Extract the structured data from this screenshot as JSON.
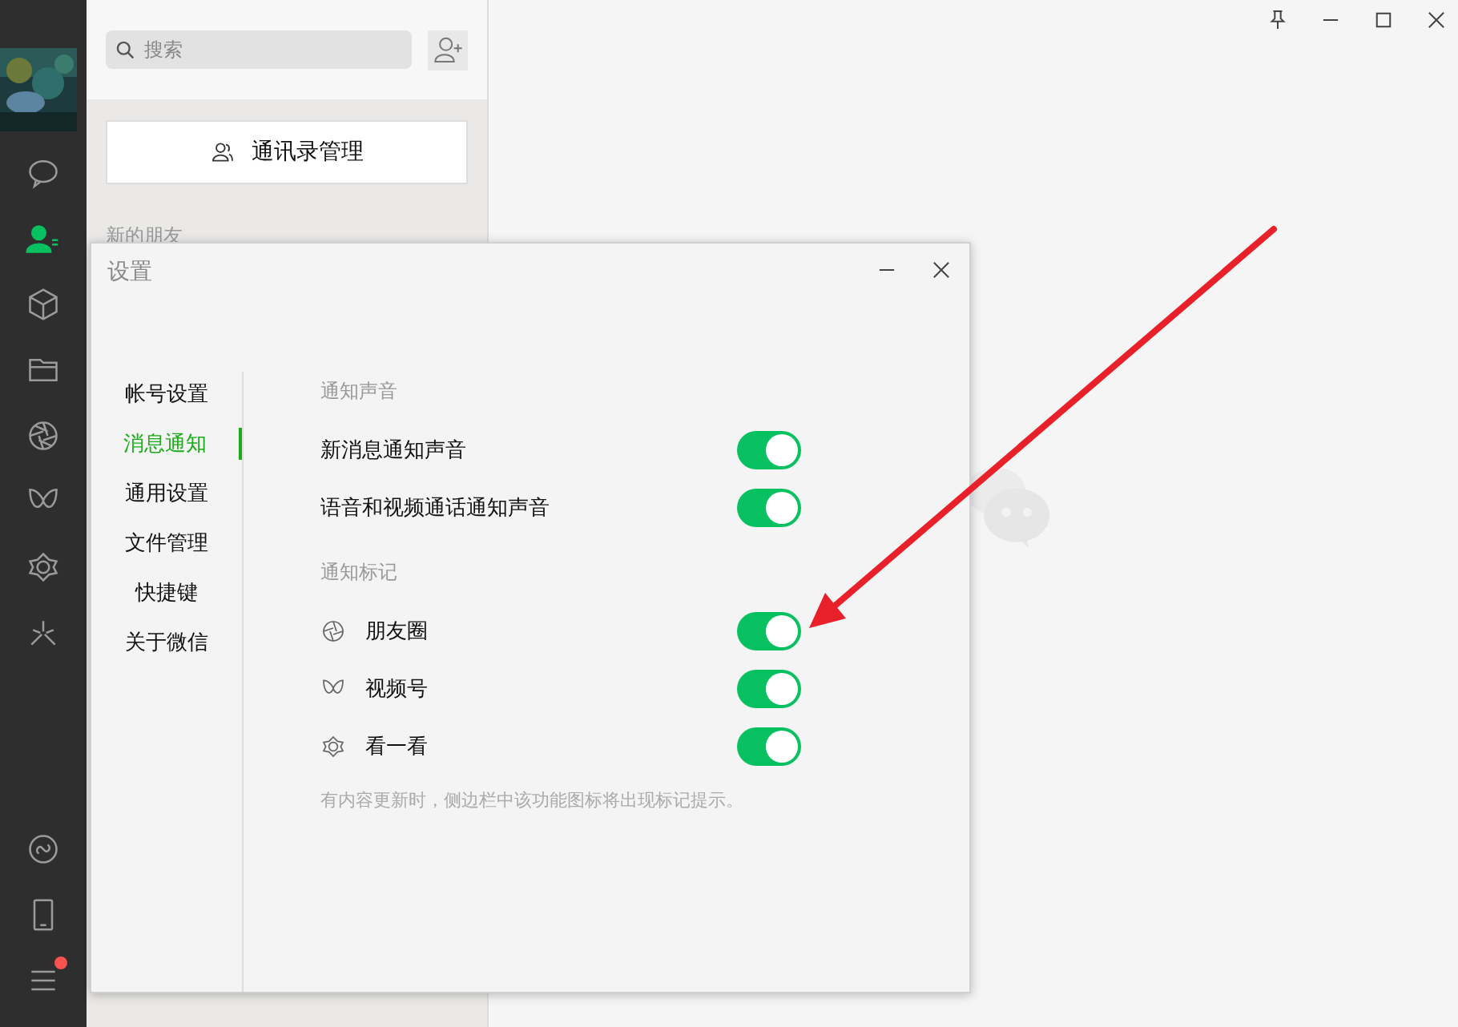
{
  "sidebar": {
    "nav": [
      {
        "kind": "chat",
        "selected": false,
        "dot": false
      },
      {
        "kind": "contacts",
        "selected": true,
        "dot": false
      },
      {
        "kind": "cube",
        "selected": false,
        "dot": false
      },
      {
        "kind": "folder",
        "selected": false,
        "dot": false
      },
      {
        "kind": "aperture",
        "selected": false,
        "dot": false
      },
      {
        "kind": "channels",
        "selected": false,
        "dot": false
      },
      {
        "kind": "flower",
        "selected": false,
        "dot": false
      },
      {
        "kind": "sparkle",
        "selected": false,
        "dot": false
      }
    ],
    "bottom": [
      {
        "kind": "miniprogram",
        "selected": false,
        "dot": false
      },
      {
        "kind": "phone",
        "selected": false,
        "dot": false
      },
      {
        "kind": "menu",
        "selected": false,
        "dot": true
      }
    ]
  },
  "contacts": {
    "search": {
      "placeholder": "搜索"
    },
    "manage_button": "通讯录管理",
    "section_label": "新的朋友"
  },
  "settings": {
    "title": "设置",
    "nav": [
      {
        "label": "帐号设置",
        "selected": false
      },
      {
        "label": "消息通知",
        "selected": true
      },
      {
        "label": "通用设置",
        "selected": false
      },
      {
        "label": "文件管理",
        "selected": false
      },
      {
        "label": "快捷键",
        "selected": false
      },
      {
        "label": "关于微信",
        "selected": false
      }
    ],
    "sections": [
      {
        "title": "通知声音",
        "items": [
          {
            "label": "新消息通知声音",
            "on": true
          },
          {
            "label": "语音和视频通话通知声音",
            "on": true
          }
        ]
      },
      {
        "title": "通知标记",
        "items": [
          {
            "label": "朋友圈",
            "kind": "aperture",
            "on": true
          },
          {
            "label": "视频号",
            "kind": "channels",
            "on": true
          },
          {
            "label": "看一看",
            "kind": "flower",
            "on": true
          }
        ],
        "note": "有内容更新时，侧边栏中该功能图标将出现标记提示。"
      }
    ]
  }
}
